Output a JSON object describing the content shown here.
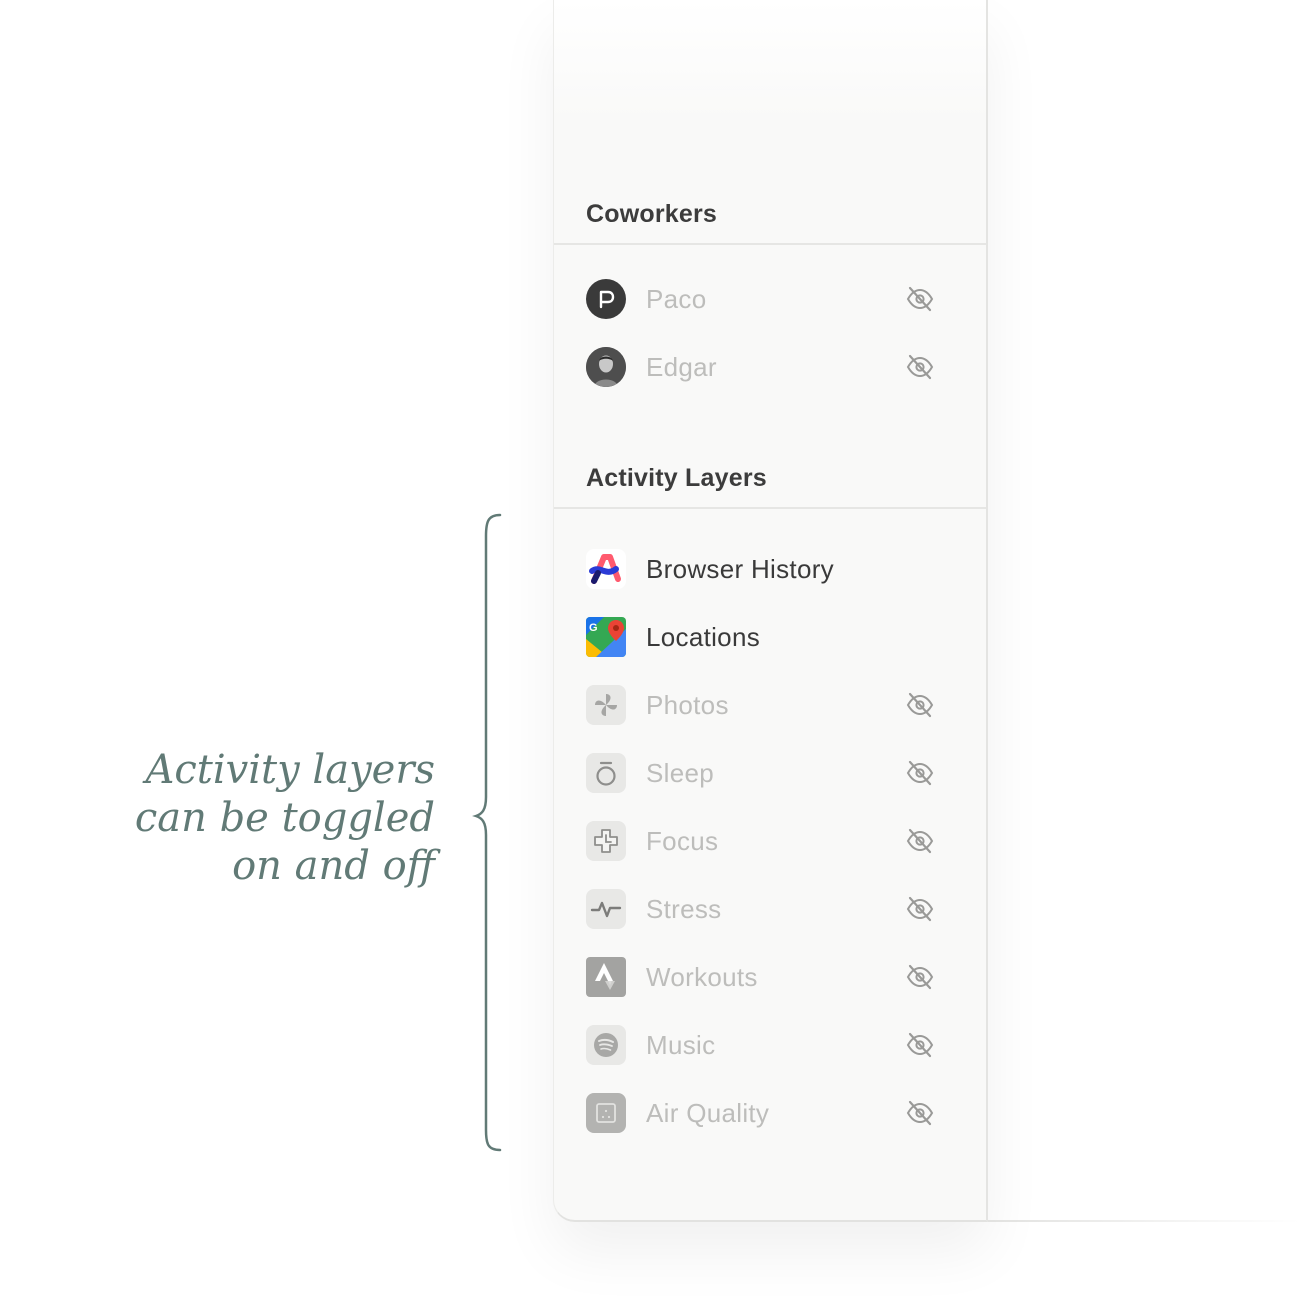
{
  "annotation": {
    "text": [
      "Activity layers",
      "can be toggled",
      "on and off"
    ]
  },
  "coworkers": {
    "title": "Coworkers",
    "items": [
      {
        "label": "Paco",
        "icon": "paco-avatar",
        "visible": false
      },
      {
        "label": "Edgar",
        "icon": "edgar-avatar",
        "visible": false
      }
    ]
  },
  "activity_layers": {
    "title": "Activity Layers",
    "items": [
      {
        "label": "Browser History",
        "icon": "arc-browser-icon",
        "visible": true
      },
      {
        "label": "Locations",
        "icon": "google-maps-icon",
        "visible": true
      },
      {
        "label": "Photos",
        "icon": "pinwheel-icon",
        "visible": false
      },
      {
        "label": "Sleep",
        "icon": "sleep-ring-icon",
        "visible": false
      },
      {
        "label": "Focus",
        "icon": "focus-icon",
        "visible": false
      },
      {
        "label": "Stress",
        "icon": "pulse-icon",
        "visible": false
      },
      {
        "label": "Workouts",
        "icon": "strava-icon",
        "visible": false
      },
      {
        "label": "Music",
        "icon": "spotify-icon",
        "visible": false
      },
      {
        "label": "Air Quality",
        "icon": "air-quality-icon",
        "visible": false
      }
    ]
  },
  "colors": {
    "annotation": "#617a76",
    "label_on": "#3a3a3a",
    "label_off": "#bdbdbb",
    "panel_bg": "#f9f9f8"
  }
}
